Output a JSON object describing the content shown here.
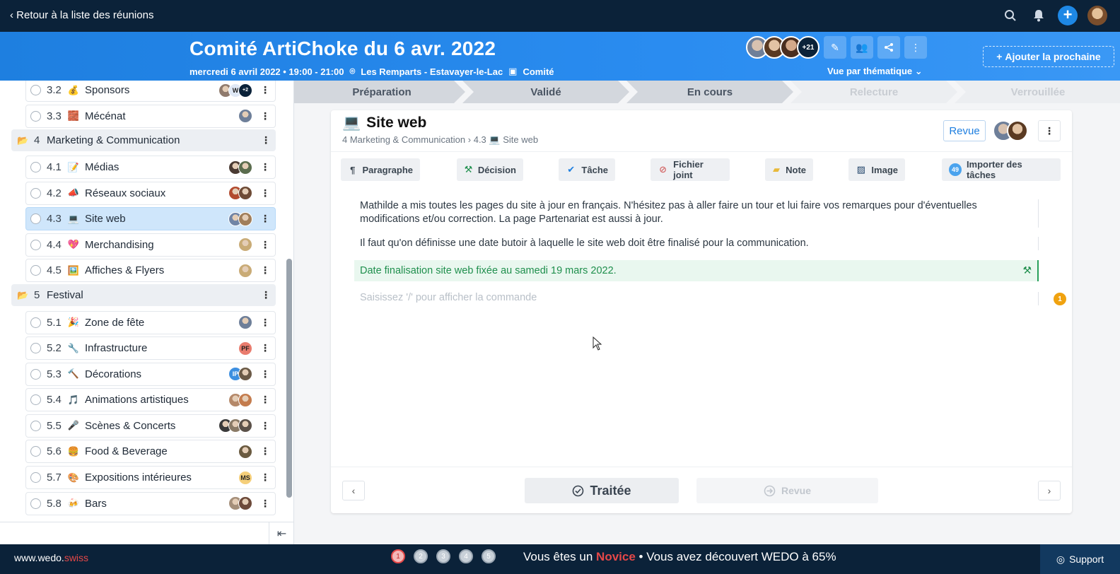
{
  "topbar": {
    "back_label": "Retour à la liste des réunions",
    "icons": [
      "search-icon",
      "bell-icon",
      "plus-icon",
      "user-avatar"
    ]
  },
  "header": {
    "title": "Comité ArtiChoke du 6 avr. 2022",
    "date_time": "mercredi 6 avril 2022 • 19:00 - 21:00",
    "location": "Les Remparts - Estavayer-le-Lac",
    "type": "Comité",
    "participants_more": "+21",
    "view_mode": "Vue par thématique",
    "add_next_label": "Ajouter la prochaine"
  },
  "sidebar": {
    "items": [
      {
        "kind": "topic",
        "num": "3.2",
        "emoji": "💰",
        "label": "Sponsors",
        "avatars": [
          "#8f7a6c",
          "W",
          "+2"
        ]
      },
      {
        "kind": "topic",
        "num": "3.3",
        "emoji": "🧱",
        "label": "Mécénat",
        "avatars": [
          "#6e7f99"
        ]
      },
      {
        "kind": "section",
        "num": "4",
        "label": "Marketing & Communication"
      },
      {
        "kind": "topic",
        "num": "4.1",
        "emoji": "📝",
        "label": "Médias",
        "avatars": [
          "#4a3b33",
          "#5b6d4e"
        ]
      },
      {
        "kind": "topic",
        "num": "4.2",
        "emoji": "📣",
        "label": "Réseaux sociaux",
        "avatars": [
          "#b24a2e",
          "#6e4b36"
        ]
      },
      {
        "kind": "topic",
        "num": "4.3",
        "emoji": "💻",
        "label": "Site web",
        "avatars": [
          "#7185a6",
          "#a07e5b"
        ],
        "active": true
      },
      {
        "kind": "topic",
        "num": "4.4",
        "emoji": "💖",
        "label": "Merchandising",
        "avatars": [
          "#c9ab76"
        ]
      },
      {
        "kind": "topic",
        "num": "4.5",
        "emoji": "🖼️",
        "label": "Affiches & Flyers",
        "avatars": [
          "#c9ab76"
        ]
      },
      {
        "kind": "section",
        "num": "5",
        "label": "Festival"
      },
      {
        "kind": "topic",
        "num": "5.1",
        "emoji": "🎉",
        "label": "Zone de fête",
        "avatars": [
          "#6e7f99"
        ]
      },
      {
        "kind": "topic",
        "num": "5.2",
        "emoji": "🔧",
        "label": "Infrastructure",
        "avatars": [
          "PF"
        ]
      },
      {
        "kind": "topic",
        "num": "5.3",
        "emoji": "🔨",
        "label": "Décorations",
        "avatars": [
          "IP",
          "#6b5a47"
        ]
      },
      {
        "kind": "topic",
        "num": "5.4",
        "emoji": "🎵",
        "label": "Animations artistiques",
        "avatars": [
          "#b5896a",
          "#c47c4e"
        ]
      },
      {
        "kind": "topic",
        "num": "5.5",
        "emoji": "🎤",
        "label": "Scènes & Concerts",
        "avatars": [
          "#3a3a3a",
          "#8a7a66",
          "#5b5149"
        ]
      },
      {
        "kind": "topic",
        "num": "5.6",
        "emoji": "🍔",
        "label": "Food & Beverage",
        "avatars": [
          "#6a5a40"
        ]
      },
      {
        "kind": "topic",
        "num": "5.7",
        "emoji": "🎨",
        "label": "Expositions intérieures",
        "avatars": [
          "MS"
        ]
      },
      {
        "kind": "topic",
        "num": "5.8",
        "emoji": "🍻",
        "label": "Bars",
        "avatars": [
          "#a58f7a",
          "#6d4a3a"
        ]
      }
    ]
  },
  "stepper": [
    "Préparation",
    "Validé",
    "En cours",
    "Relecture",
    "Verrouillée"
  ],
  "card": {
    "emoji": "💻",
    "title": "Site web",
    "breadcrumb_section": "4 Marketing & Communication",
    "breadcrumb_topic": "4.3",
    "breadcrumb_topic_label": "Site web",
    "revue_label": "Revue",
    "toolbar": {
      "paragraph": "Paragraphe",
      "decision": "Décision",
      "task": "Tâche",
      "attachment": "Fichier joint",
      "note": "Note",
      "image": "Image",
      "import_count": "49",
      "import": "Importer des tâches"
    },
    "paragraph_1": "Mathilde a mis toutes les pages du site à jour en français. N'hésitez pas à aller faire un tour et lui faire vos remarques pour d'éventuelles modifications et/ou correction. La page Partenariat est aussi à jour.",
    "paragraph_2": "Il faut qu'on définisse une date butoir à laquelle le site web doit être finalisé pour la communication.",
    "decision": "Date finalisation site web fixée au samedi 19 mars 2022.",
    "placeholder": "Saisissez '/' pour afficher la commande",
    "badge_count": "1",
    "treated_label": "Traitée",
    "review_label": "Revue"
  },
  "bottombar": {
    "site_prefix": "www.wedo.",
    "site_suffix": "swiss",
    "dots": [
      "1",
      "2",
      "3",
      "4",
      "5"
    ],
    "msg_prefix": "Vous êtes un",
    "level": "Novice",
    "msg_suffix": "• Vous avez découvert WEDO à 65%",
    "support_label": "Support"
  },
  "colors": {
    "topbar": "#0b2239",
    "header_blue": "#1e7fe0",
    "active_item": "#cfe6fb",
    "decision_green": "#1f8f4d",
    "accent_red": "#e54848"
  }
}
